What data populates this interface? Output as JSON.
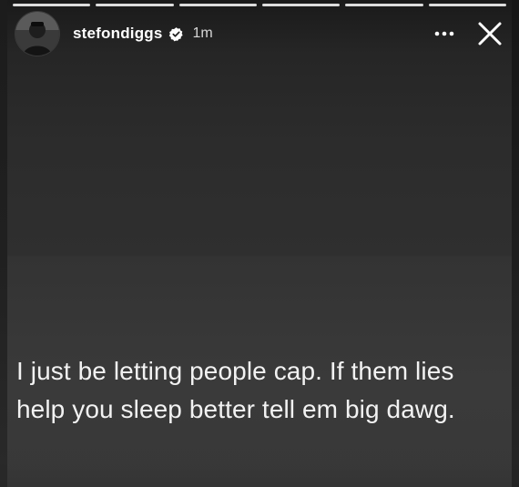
{
  "story": {
    "progress_segments": 6,
    "user": {
      "username": "stefondiggs",
      "verified": true,
      "timestamp": "1m",
      "avatar": "avatar-photo"
    },
    "actions": {
      "more_icon": "more-options-icon",
      "close_icon": "close-icon"
    },
    "caption": "I just be letting people cap. If them lies help you sleep better tell em big dawg."
  }
}
